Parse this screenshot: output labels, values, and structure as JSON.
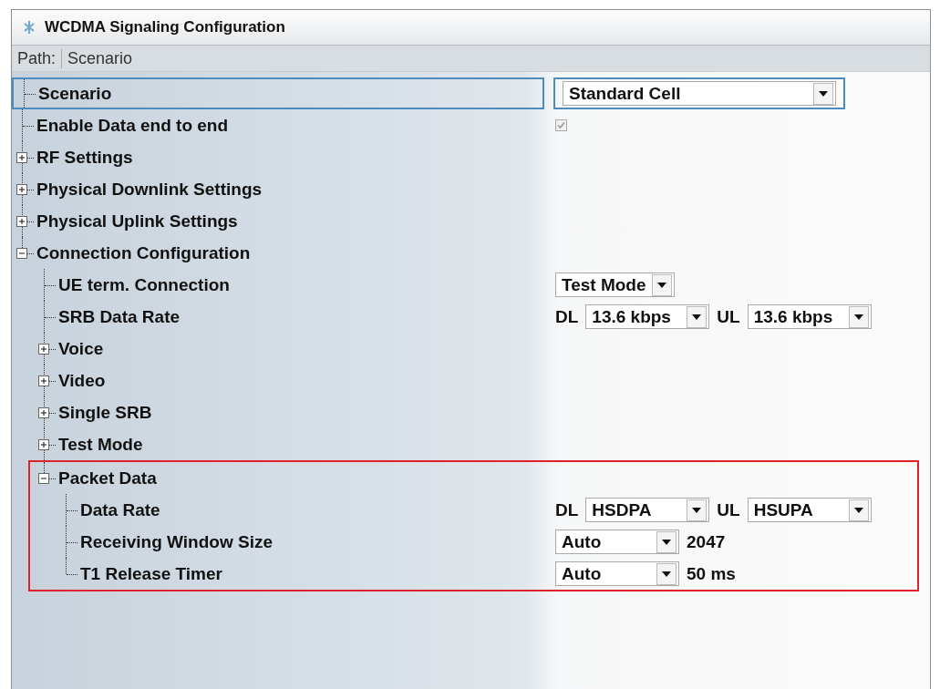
{
  "window": {
    "title": "WCDMA Signaling Configuration"
  },
  "path": {
    "label": "Path:",
    "value": "Scenario"
  },
  "tree": [
    {
      "label": "Scenario",
      "selected": true,
      "kind": "combo",
      "value": "Standard Cell"
    },
    {
      "label": "Enable Data end to end",
      "selected": false,
      "kind": "checkbox",
      "checked": true,
      "disabled": true
    },
    {
      "label": "RF Settings",
      "selected": false,
      "kind": "group",
      "expanded": false
    },
    {
      "label": "Physical Downlink Settings",
      "selected": false,
      "kind": "group",
      "expanded": false
    },
    {
      "label": "Physical Uplink Settings",
      "selected": false,
      "kind": "group",
      "expanded": false
    },
    {
      "label": "Connection Configuration",
      "selected": false,
      "kind": "group",
      "expanded": true,
      "children": [
        {
          "label": "UE term. Connection",
          "selected": false,
          "kind": "combo",
          "value": "Test Mode"
        },
        {
          "label": "SRB Data Rate",
          "selected": false,
          "kind": "dual",
          "dl_label": "DL",
          "dl_value": "13.6 kbps",
          "ul_label": "UL",
          "ul_value": "13.6 kbps"
        },
        {
          "label": "Voice",
          "selected": false,
          "kind": "group",
          "expanded": false
        },
        {
          "label": "Video",
          "selected": false,
          "kind": "group",
          "expanded": false
        },
        {
          "label": "Single SRB",
          "selected": false,
          "kind": "group",
          "expanded": false
        },
        {
          "label": "Test Mode",
          "selected": false,
          "kind": "group",
          "expanded": false
        },
        {
          "label": "Packet Data",
          "selected": false,
          "kind": "group",
          "expanded": true,
          "highlighted": true,
          "children": [
            {
              "label": "Data Rate",
              "selected": false,
              "kind": "dual",
              "dl_label": "DL",
              "dl_value": "HSDPA",
              "ul_label": "UL",
              "ul_value": "HSUPA"
            },
            {
              "label": "Receiving Window Size",
              "selected": false,
              "kind": "combo-text",
              "value": "Auto",
              "text": "2047"
            },
            {
              "label": "T1 Release Timer",
              "selected": false,
              "kind": "combo-text",
              "value": "Auto",
              "text": "50 ms"
            }
          ]
        }
      ]
    }
  ]
}
